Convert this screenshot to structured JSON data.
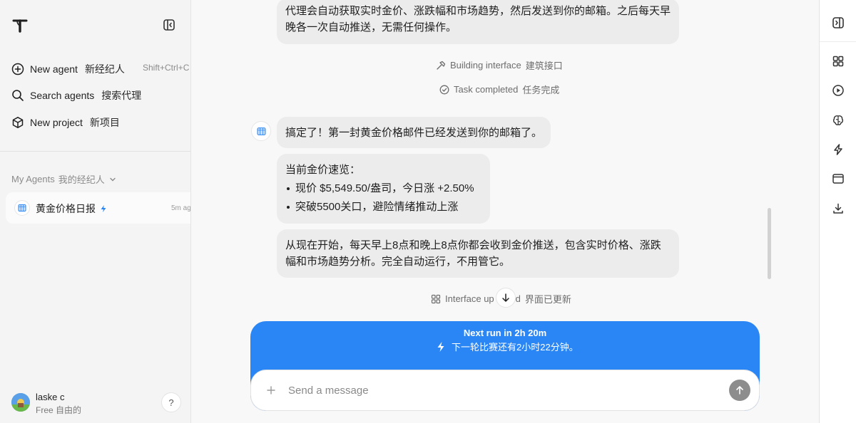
{
  "sidebar": {
    "nav": [
      {
        "label": "New agent",
        "label_zh": "新经纪人",
        "icon": "plus-circle-icon"
      },
      {
        "label": "Search agents",
        "label_zh": "搜索代理",
        "icon": "search-icon"
      },
      {
        "label": "New project",
        "label_zh": "新项目",
        "icon": "cube-icon"
      }
    ],
    "shortcut": "Shift+Ctrl+C",
    "section_title": "My Agents",
    "section_title_zh": "我的经纪人",
    "agents": [
      {
        "name": "黄金价格日报",
        "time": "5m ag",
        "icon": "lightning-icon"
      }
    ],
    "user": {
      "name": "laske c",
      "plan": "Free",
      "plan_zh": "自由的"
    },
    "help_label": "?"
  },
  "chat": {
    "top_message": [
      "代理会自动获取实时金价、涨跌幅和市场趋势，然后发送到你的邮箱。之后每天早",
      "晚各一次自动推送，无需任何操作。"
    ],
    "status_building": {
      "label": "Building interface",
      "label_zh": "建筑接口"
    },
    "status_completed": {
      "label": "Task completed",
      "label_zh": "任务完成"
    },
    "reply_1": "搞定了！第一封黄金价格邮件已经发送到你的邮箱了。",
    "reply_2": {
      "heading": "当前金价速览：",
      "bullets": [
        "现价 $5,549.50/盎司，今日涨 +2.50%",
        "突破5500关口，避险情绪推动上涨"
      ]
    },
    "reply_3": [
      "从现在开始，每天早上8点和晚上8点你都会收到金价推送，包含实时价格、涨跌",
      "幅和市场趋势分析。完全自动运行，不用管它。"
    ],
    "status_updated": {
      "label_a": "Interface up",
      "label_b": "d",
      "label_zh": "界面已更新"
    }
  },
  "run_card": {
    "title": "Next run in 2h 20m",
    "subtitle": "下一轮比赛还有2小时22分钟。"
  },
  "composer": {
    "placeholder": "Send a message",
    "value": ""
  },
  "rail": {
    "icons": [
      "sidebar-toggle-icon",
      "grid-icon",
      "play-icon",
      "brain-icon",
      "lightning-icon",
      "browser-icon",
      "download-icon"
    ]
  },
  "colors": {
    "accent": "#2a86f5",
    "bubble": "#ececec",
    "sidebar_bg": "#f4f4f4",
    "main_bg": "#f8f8f8"
  }
}
